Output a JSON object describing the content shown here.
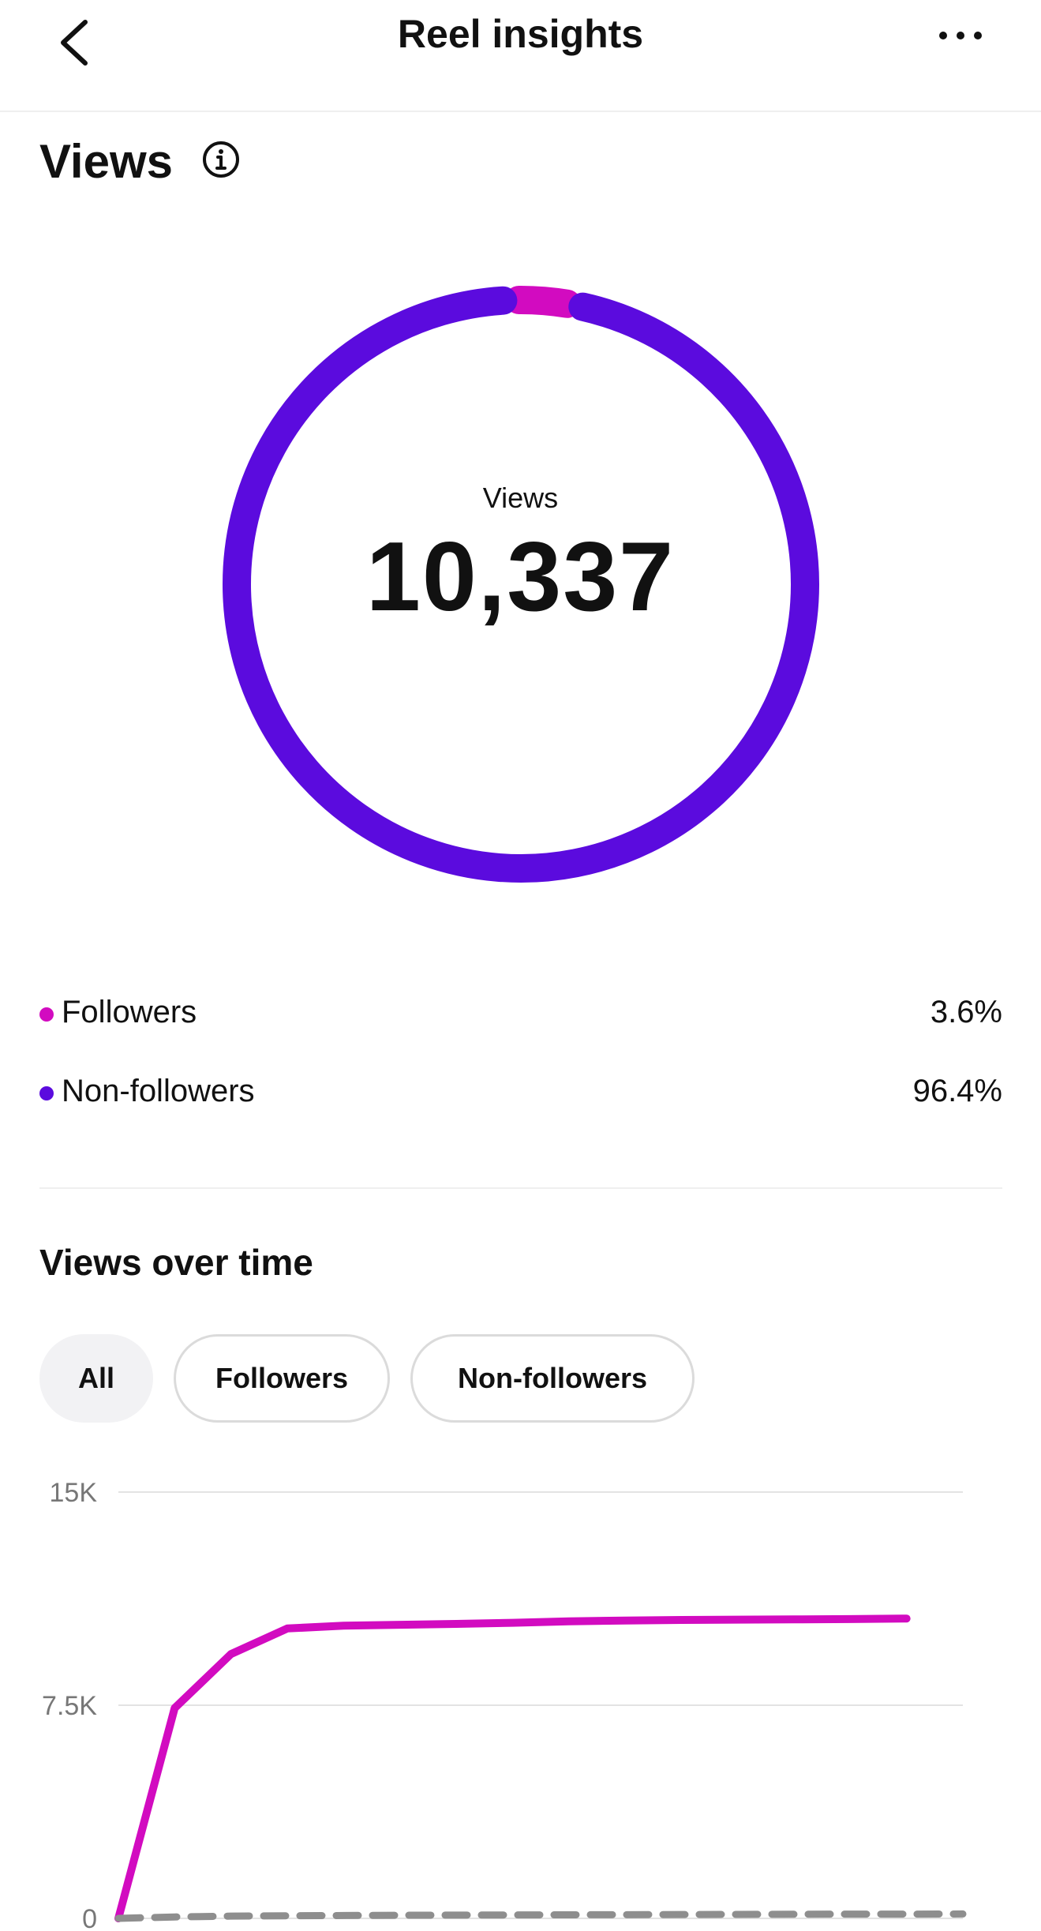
{
  "header": {
    "title": "Reel insights",
    "back_icon": "chevron-left-icon",
    "more_icon": "more-horizontal-icon"
  },
  "views_section": {
    "title": "Views",
    "info_icon": "info-icon",
    "donut": {
      "center_label": "Views",
      "center_value": "10,337",
      "segments": [
        {
          "name": "Followers",
          "percent": 3.6,
          "color": "#D20BC0"
        },
        {
          "name": "Non-followers",
          "percent": 96.4,
          "color": "#5B0BDE"
        }
      ]
    },
    "legend": [
      {
        "name": "Followers",
        "value": "3.6%",
        "color": "#D20BC0"
      },
      {
        "name": "Non-followers",
        "value": "96.4%",
        "color": "#5B0BDE"
      }
    ]
  },
  "views_over_time": {
    "title": "Views over time",
    "filters": [
      {
        "label": "All",
        "active": true
      },
      {
        "label": "Followers",
        "active": false
      },
      {
        "label": "Non-followers",
        "active": false
      }
    ]
  },
  "chart_data": {
    "type": "line",
    "yticks": [
      "15K",
      "7.5K",
      "0"
    ],
    "ylim": [
      0,
      15000
    ],
    "x": [
      0,
      1,
      2,
      3,
      4,
      5,
      6,
      7,
      8,
      9,
      10,
      11,
      12,
      13,
      14,
      15
    ],
    "series": [
      {
        "color": "#D20BC0",
        "style": "solid",
        "values": [
          0,
          7400,
          9300,
          10200,
          10300,
          10330,
          10360,
          10400,
          10450,
          10480,
          10500,
          10510,
          10520,
          10530,
          10550
        ]
      },
      {
        "color": "#8E8E8E",
        "style": "dashed",
        "values": [
          0,
          50,
          80,
          90,
          100,
          110,
          115,
          120,
          125,
          130,
          135,
          140,
          145,
          150,
          150,
          155
        ]
      }
    ],
    "grid": true
  }
}
